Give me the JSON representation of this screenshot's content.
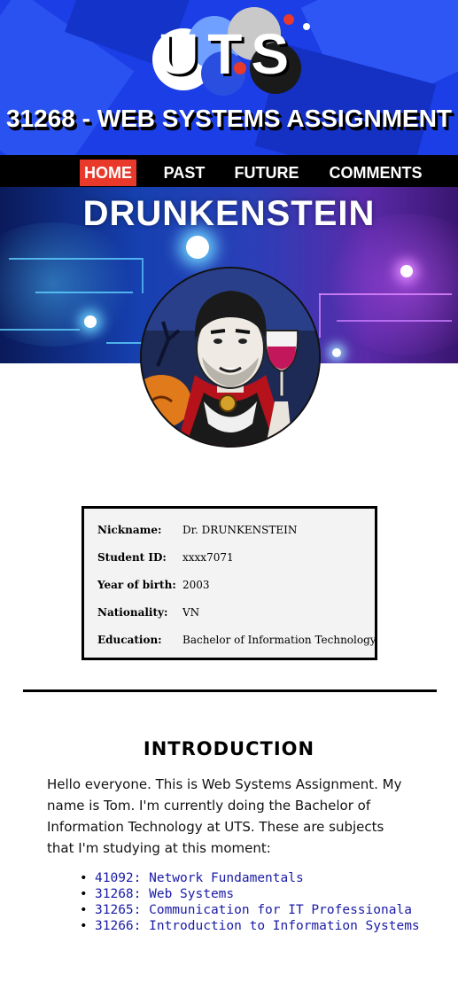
{
  "header": {
    "logo_text": "UTS",
    "title": "31268 - WEB SYSTEMS ASSIGNMENT"
  },
  "nav": {
    "items": [
      {
        "label": "HOME",
        "active": true
      },
      {
        "label": "PAST",
        "active": false
      },
      {
        "label": "FUTURE",
        "active": false
      },
      {
        "label": "COMMENTS",
        "active": false
      }
    ],
    "active_color": "#e8392b"
  },
  "banner": {
    "title": "DRUNKENSTEIN"
  },
  "profile": {
    "rows": [
      {
        "label": "Nickname:",
        "value": "Dr. DRUNKENSTEIN"
      },
      {
        "label": "Student ID:",
        "value": "xxxx7071"
      },
      {
        "label": "Year of birth:",
        "value": "2003"
      },
      {
        "label": "Nationality:",
        "value": "VN"
      },
      {
        "label": "Education:",
        "value": "Bachelor of Information Technology"
      }
    ]
  },
  "intro": {
    "title": "INTRODUCTION",
    "text": "Hello everyone. This is Web Systems Assignment. My name is Tom. I'm currently doing the Bachelor of Information Technology at UTS. These are subjects that I'm studying at this moment:",
    "subjects": [
      "41092: Network Fundamentals",
      "31268: Web Systems",
      "31265: Communication for IT Professionala",
      "31266: Introduction to Information Systems"
    ]
  },
  "colors": {
    "header_bg": "#1b3ee6",
    "link": "#1a1aa6"
  }
}
